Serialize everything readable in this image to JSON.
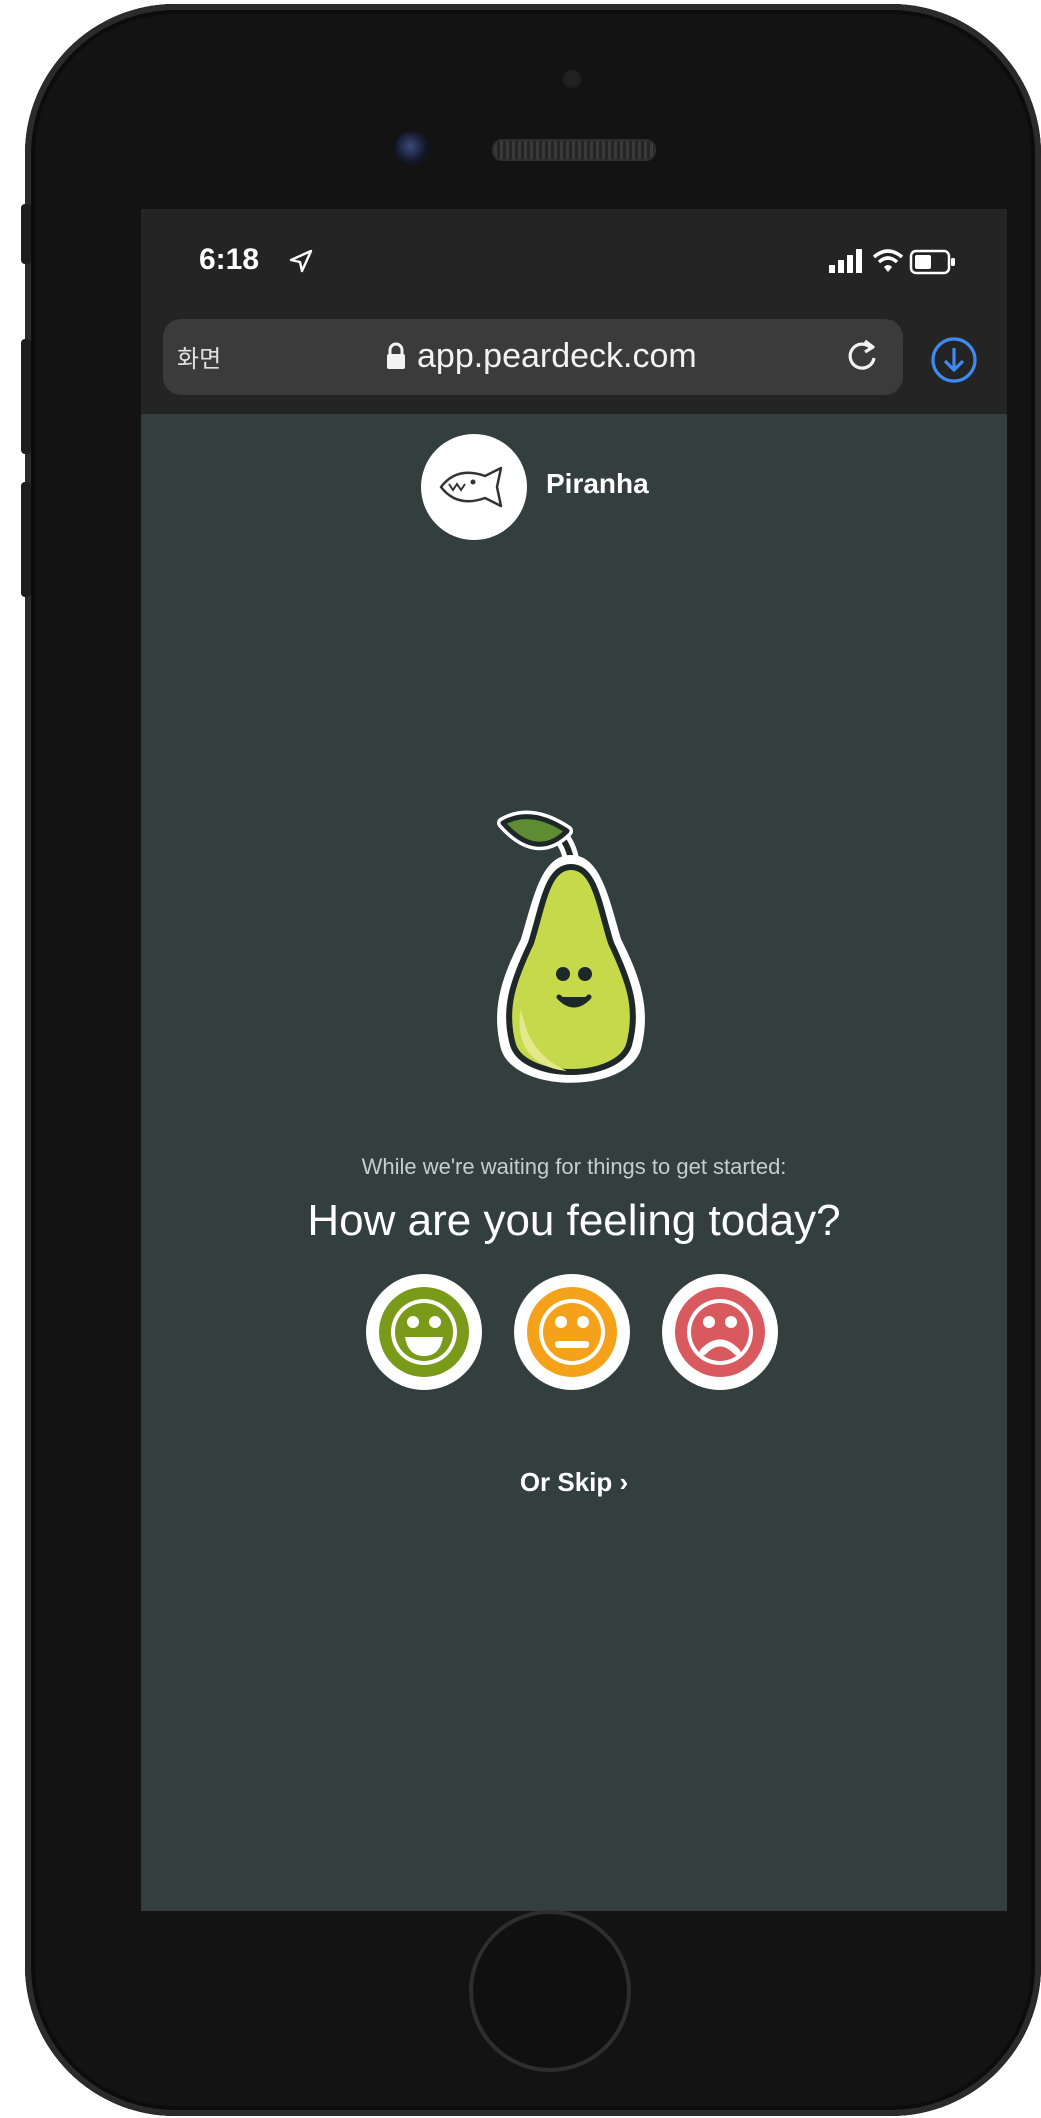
{
  "status_bar": {
    "time": "6:18",
    "icons": [
      "location-arrow-icon",
      "cellular-signal-icon",
      "wifi-icon",
      "battery-icon"
    ]
  },
  "browser": {
    "reader_button": "화면",
    "url": "app.peardeck.com",
    "icons": [
      "lock-icon",
      "reload-icon",
      "download-icon"
    ]
  },
  "session": {
    "avatar_icon": "fish-icon",
    "room_name": "Piranha"
  },
  "mood_check": {
    "subtitle": "While we're waiting for things to get started:",
    "question": "How are you feeling today?",
    "options": [
      {
        "mood": "happy",
        "icon": "happy-face-icon",
        "color": "#7a9a1a"
      },
      {
        "mood": "neutral",
        "icon": "neutral-face-icon",
        "color": "#f5a21b"
      },
      {
        "mood": "sad",
        "icon": "sad-face-icon",
        "color": "#d85a5e"
      }
    ],
    "skip_label": "Or Skip ›"
  },
  "colors": {
    "page_background": "#333e3e",
    "browser_chrome": "#242424",
    "link_blue": "#3d8bf2",
    "pear_green": "#c5d94b"
  }
}
